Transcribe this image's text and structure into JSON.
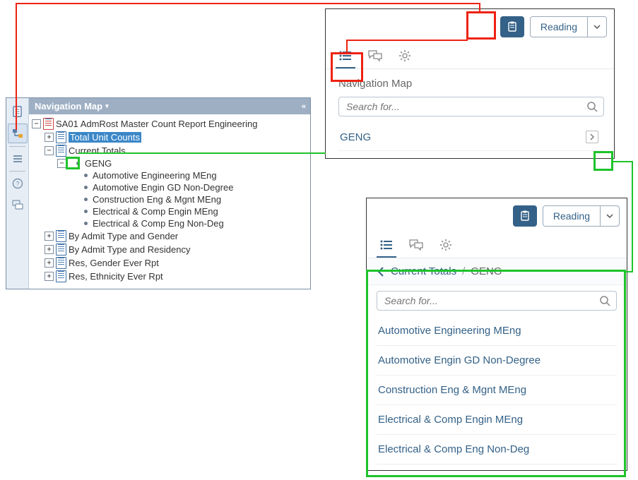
{
  "left": {
    "header": "Navigation Map",
    "root": "SA01 AdmRost Master Count Report Engineering",
    "nodes": {
      "total_unit_counts": "Total Unit Counts",
      "current_totals": "Current Totals",
      "geng": "GENG",
      "geng_children": [
        "Automotive Engineering MEng",
        "Automotive Engin GD Non-Degree",
        "Construction Eng & Mgnt MEng",
        "Electrical & Comp Engin MEng",
        "Electrical & Comp Eng Non-Deg"
      ],
      "by_admit_gender": "By Admit Type and Gender",
      "by_admit_res": "By Admit Type and Residency",
      "res_gender": "Res, Gender Ever Rpt",
      "res_eth": "Res, Ethnicity Ever Rpt"
    }
  },
  "panel_a": {
    "reading_label": "Reading",
    "title": "Navigation Map",
    "search_placeholder": "Search for...",
    "item": "GENG"
  },
  "panel_b": {
    "reading_label": "Reading",
    "crumb_parent": "Current Totals",
    "crumb_current": "GENG",
    "crumb_sep": "/",
    "search_placeholder": "Search for...",
    "items": [
      "Automotive Engineering MEng",
      "Automotive Engin GD Non-Degree",
      "Construction Eng & Mgnt MEng",
      "Electrical & Comp Engin MEng",
      "Electrical & Comp Eng Non-Deg"
    ]
  }
}
